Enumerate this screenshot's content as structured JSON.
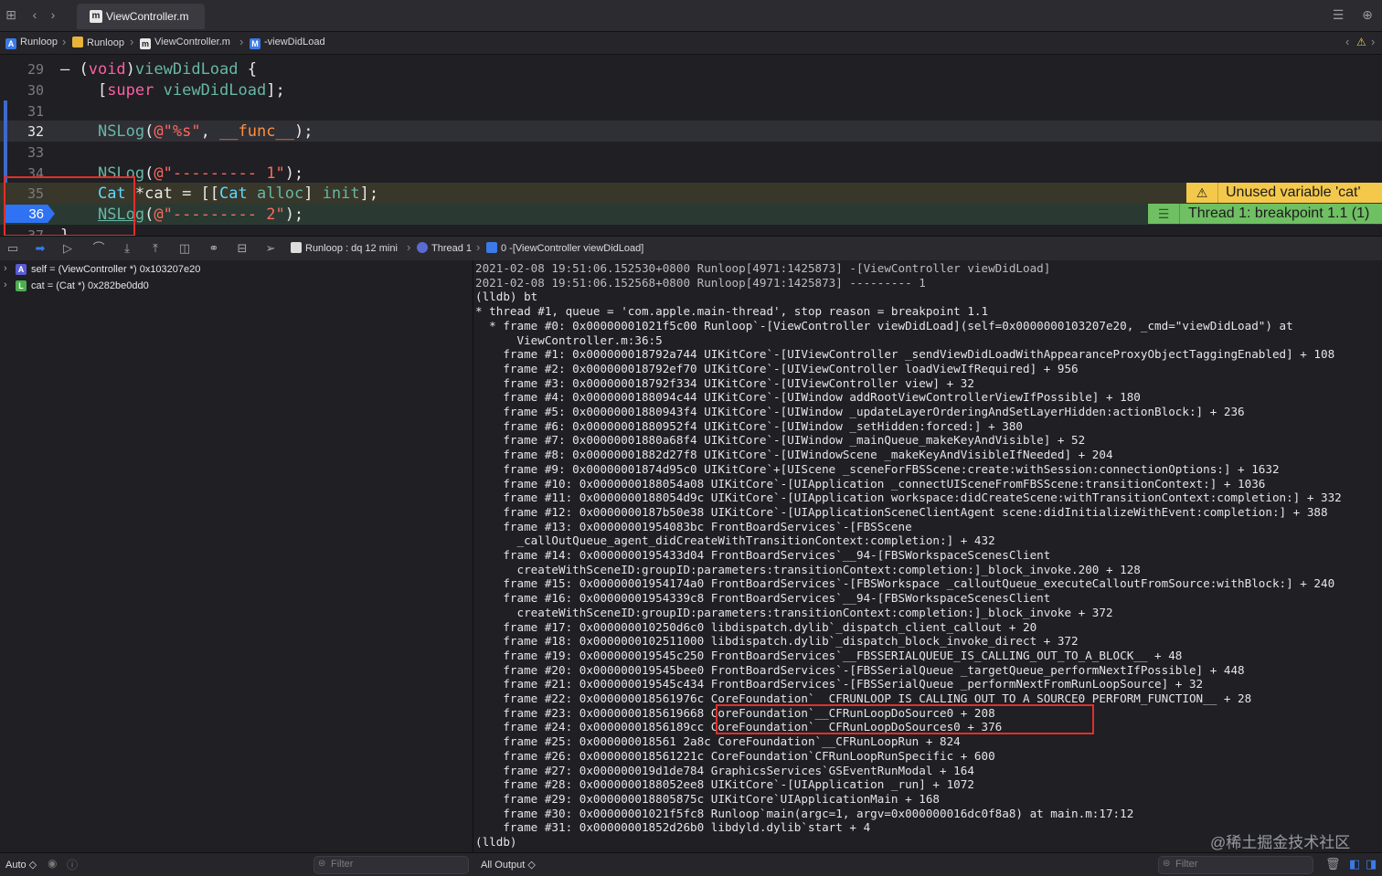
{
  "tab": {
    "title": "ViewController.m"
  },
  "jumpbar": {
    "crumbs": [
      "Runloop",
      "Runloop",
      "ViewController.m",
      "-viewDidLoad"
    ]
  },
  "editor": {
    "lines": [
      {
        "num": "29"
      },
      {
        "num": "30"
      },
      {
        "num": "31"
      },
      {
        "num": "32"
      },
      {
        "num": "33"
      },
      {
        "num": "34"
      },
      {
        "num": "35"
      },
      {
        "num": "36"
      },
      {
        "num": "37"
      }
    ],
    "code": {
      "l29": [
        "– (",
        "void",
        ")",
        "viewDidLoad",
        " {"
      ],
      "l30": [
        "    [",
        "super",
        " ",
        "viewDidLoad",
        "];"
      ],
      "l32": [
        "    ",
        "NSLog",
        "(",
        "@\"%s\"",
        ", ",
        "__func__",
        ");"
      ],
      "l34": [
        "    ",
        "NSLog",
        "(",
        "@\"--------- 1\"",
        ");"
      ],
      "l35": [
        "    ",
        "Cat",
        " *cat = [[",
        "Cat",
        " ",
        "alloc",
        "] ",
        "init",
        "];"
      ],
      "l36": [
        "    ",
        "NSLog",
        "(",
        "@\"--------- 2\"",
        ");"
      ],
      "l37": [
        "}"
      ]
    },
    "warning": "Unused variable 'cat'",
    "breakpoint": "Thread 1: breakpoint 1.1 (1)"
  },
  "debugbar": {
    "scheme": "Runloop : dq 12 mini",
    "thread": "Thread 1",
    "frame": "0 -[ViewController viewDidLoad]"
  },
  "variables": [
    {
      "tag": "A",
      "text": "self = (ViewController *) 0x103207e20"
    },
    {
      "tag": "L",
      "text": "cat = (Cat *) 0x282be0dd0"
    }
  ],
  "console": {
    "lines": [
      "2021-02-08 19:51:06.152530+0800 Runloop[4971:1425873] -[ViewController viewDidLoad]",
      "2021-02-08 19:51:06.152568+0800 Runloop[4971:1425873] --------- 1",
      "(lldb) bt",
      "* thread #1, queue = 'com.apple.main-thread', stop reason = breakpoint 1.1",
      "  * frame #0: 0x00000001021f5c00 Runloop`-[ViewController viewDidLoad](self=0x0000000103207e20, _cmd=\"viewDidLoad\") at",
      "      ViewController.m:36:5",
      "    frame #1: 0x000000018792a744 UIKitCore`-[UIViewController _sendViewDidLoadWithAppearanceProxyObjectTaggingEnabled] + 108",
      "    frame #2: 0x000000018792ef70 UIKitCore`-[UIViewController loadViewIfRequired] + 956",
      "    frame #3: 0x000000018792f334 UIKitCore`-[UIViewController view] + 32",
      "    frame #4: 0x0000000188094c44 UIKitCore`-[UIWindow addRootViewControllerViewIfPossible] + 180",
      "    frame #5: 0x00000001880943f4 UIKitCore`-[UIWindow _updateLayerOrderingAndSetLayerHidden:actionBlock:] + 236",
      "    frame #6: 0x00000001880952f4 UIKitCore`-[UIWindow _setHidden:forced:] + 380",
      "    frame #7: 0x00000001880a68f4 UIKitCore`-[UIWindow _mainQueue_makeKeyAndVisible] + 52",
      "    frame #8: 0x00000001882d27f8 UIKitCore`-[UIWindowScene _makeKeyAndVisibleIfNeeded] + 204",
      "    frame #9: 0x00000001874d95c0 UIKitCore`+[UIScene _sceneForFBSScene:create:withSession:connectionOptions:] + 1632",
      "    frame #10: 0x0000000188054a08 UIKitCore`-[UIApplication _connectUISceneFromFBSScene:transitionContext:] + 1036",
      "    frame #11: 0x0000000188054d9c UIKitCore`-[UIApplication workspace:didCreateScene:withTransitionContext:completion:] + 332",
      "    frame #12: 0x0000000187b50e38 UIKitCore`-[UIApplicationSceneClientAgent scene:didInitializeWithEvent:completion:] + 388",
      "    frame #13: 0x00000001954083bc FrontBoardServices`-[FBSScene",
      "      _callOutQueue_agent_didCreateWithTransitionContext:completion:] + 432",
      "    frame #14: 0x0000000195433d04 FrontBoardServices`__94-[FBSWorkspaceScenesClient",
      "      createWithSceneID:groupID:parameters:transitionContext:completion:]_block_invoke.200 + 128",
      "    frame #15: 0x00000001954174a0 FrontBoardServices`-[FBSWorkspace _calloutQueue_executeCalloutFromSource:withBlock:] + 240",
      "    frame #16: 0x00000001954339c8 FrontBoardServices`__94-[FBSWorkspaceScenesClient",
      "      createWithSceneID:groupID:parameters:transitionContext:completion:]_block_invoke + 372",
      "    frame #17: 0x000000010250d6c0 libdispatch.dylib`_dispatch_client_callout + 20",
      "    frame #18: 0x0000000102511000 libdispatch.dylib`_dispatch_block_invoke_direct + 372",
      "    frame #19: 0x000000019545c250 FrontBoardServices`__FBSSERIALQUEUE_IS_CALLING_OUT_TO_A_BLOCK__ + 48",
      "    frame #20: 0x000000019545bee0 FrontBoardServices`-[FBSSerialQueue _targetQueue_performNextIfPossible] + 448",
      "    frame #21: 0x000000019545c434 FrontBoardServices`-[FBSSerialQueue _performNextFromRunLoopSource] + 32",
      "    frame #22: 0x000000018561976c CoreFoundation`__CFRUNLOOP_IS_CALLING_OUT_TO_A_SOURCE0_PERFORM_FUNCTION__ + 28",
      "    frame #23: 0x0000000185619668 CoreFoundation`__CFRunLoopDoSource0 + 208",
      "    frame #24: 0x00000001856189cc CoreFoundation`__CFRunLoopDoSources0 + 376",
      "    frame #25: 0x000000018561 2a8c CoreFoundation`__CFRunLoopRun + 824",
      "    frame #26: 0x000000018561221c CoreFoundation`CFRunLoopRunSpecific + 600",
      "    frame #27: 0x000000019d1de784 GraphicsServices`GSEventRunModal + 164",
      "    frame #28: 0x0000000188052ee8 UIKitCore`-[UIApplication _run] + 1072",
      "    frame #29: 0x000000018805875c UIKitCore`UIApplicationMain + 168",
      "    frame #30: 0x00000001021f5fc8 Runloop`main(argc=1, argv=0x000000016dc0f8a8) at main.m:17:12",
      "    frame #31: 0x00000001852d26b0 libdyld.dylib`start + 4",
      "(lldb)"
    ]
  },
  "bottombar": {
    "auto": "Auto ◇",
    "filter_left": "Filter",
    "all_output": "All Output ◇",
    "filter_right": "Filter"
  },
  "watermark": "@稀土掘金技术社区",
  "colors": {
    "breakpoint": "#2f72f3",
    "warning": "#f4c84a",
    "bp_badge": "#6fbf63",
    "annotation": "#e0302a"
  }
}
